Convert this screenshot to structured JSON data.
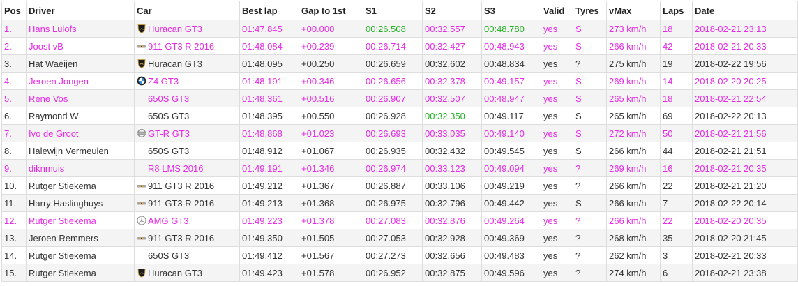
{
  "columns": [
    "Pos",
    "Driver",
    "Car",
    "Best lap",
    "Gap to 1st",
    "S1",
    "S2",
    "S3",
    "Valid",
    "Tyres",
    "vMax",
    "Laps",
    "Date"
  ],
  "colors": {
    "highlight": "#e82ae8",
    "best_sector": "#22b022",
    "text": "#333333",
    "row_alt": "#f4f4f4",
    "border": "#dddddd"
  },
  "rows": [
    {
      "pos": "1.",
      "driver": "Hans Lulofs",
      "logo": "lamborghini-logo-icon",
      "car": "Huracan GT3",
      "best": "01:47.845",
      "gap": "+00.000",
      "s1": "00:26.508",
      "s2": "00:32.557",
      "s3": "00:48.780",
      "valid": "yes",
      "tyres": "S",
      "vmax": "273 km/h",
      "laps": "18",
      "date": "2018-02-21 23:13",
      "hl": true,
      "best_sectors": [
        "s1",
        "s3"
      ]
    },
    {
      "pos": "2.",
      "driver": "Joost vB",
      "logo": "porsche-logo-icon",
      "car": "911 GT3 R 2016",
      "best": "01:48.084",
      "gap": "+00.239",
      "s1": "00:26.714",
      "s2": "00:32.427",
      "s3": "00:48.943",
      "valid": "yes",
      "tyres": "S",
      "vmax": "266 km/h",
      "laps": "42",
      "date": "2018-02-21 20:33",
      "hl": true,
      "best_sectors": []
    },
    {
      "pos": "3.",
      "driver": "Hat Waeijen",
      "logo": "lamborghini-logo-icon",
      "car": "Huracan GT3",
      "best": "01:48.095",
      "gap": "+00.250",
      "s1": "00:26.659",
      "s2": "00:32.602",
      "s3": "00:48.834",
      "valid": "yes",
      "tyres": "?",
      "vmax": "275 km/h",
      "laps": "19",
      "date": "2018-02-22 19:56",
      "hl": false,
      "best_sectors": []
    },
    {
      "pos": "4.",
      "driver": "Jeroen Jongen",
      "logo": "bmw-logo-icon",
      "car": "Z4 GT3",
      "best": "01:48.191",
      "gap": "+00.346",
      "s1": "00:26.656",
      "s2": "00:32.378",
      "s3": "00:49.157",
      "valid": "yes",
      "tyres": "S",
      "vmax": "269 km/h",
      "laps": "14",
      "date": "2018-02-20 20:25",
      "hl": true,
      "best_sectors": []
    },
    {
      "pos": "5.",
      "driver": "Rene Vos",
      "logo": "",
      "car": "650S GT3",
      "best": "01:48.361",
      "gap": "+00.516",
      "s1": "00:26.907",
      "s2": "00:32.507",
      "s3": "00:48.947",
      "valid": "yes",
      "tyres": "S",
      "vmax": "265 km/h",
      "laps": "18",
      "date": "2018-02-21 22:54",
      "hl": true,
      "best_sectors": []
    },
    {
      "pos": "6.",
      "driver": "Raymond W",
      "logo": "",
      "car": "650S GT3",
      "best": "01:48.395",
      "gap": "+00.550",
      "s1": "00:26.928",
      "s2": "00:32.350",
      "s3": "00:49.117",
      "valid": "yes",
      "tyres": "S",
      "vmax": "265 km/h",
      "laps": "69",
      "date": "2018-02-22 20:13",
      "hl": false,
      "best_sectors": [
        "s2"
      ]
    },
    {
      "pos": "7.",
      "driver": "Ivo de Groot",
      "logo": "nissan-logo-icon",
      "car": "GT-R GT3",
      "best": "01:48.868",
      "gap": "+01.023",
      "s1": "00:26.693",
      "s2": "00:33.035",
      "s3": "00:49.140",
      "valid": "yes",
      "tyres": "S",
      "vmax": "272 km/h",
      "laps": "50",
      "date": "2018-02-21 21:56",
      "hl": true,
      "best_sectors": []
    },
    {
      "pos": "8.",
      "driver": "Halewijn Vermeulen",
      "logo": "",
      "car": "650S GT3",
      "best": "01:48.912",
      "gap": "+01.067",
      "s1": "00:26.935",
      "s2": "00:32.432",
      "s3": "00:49.545",
      "valid": "yes",
      "tyres": "S",
      "vmax": "266 km/h",
      "laps": "44",
      "date": "2018-02-21 21:51",
      "hl": false,
      "best_sectors": []
    },
    {
      "pos": "9.",
      "driver": "diknmuis",
      "logo": "",
      "car": "R8 LMS 2016",
      "best": "01:49.191",
      "gap": "+01.346",
      "s1": "00:26.974",
      "s2": "00:33.123",
      "s3": "00:49.094",
      "valid": "yes",
      "tyres": "?",
      "vmax": "269 km/h",
      "laps": "16",
      "date": "2018-02-21 20:35",
      "hl": true,
      "best_sectors": []
    },
    {
      "pos": "10.",
      "driver": "Rutger Stiekema",
      "logo": "porsche-logo-icon",
      "car": "911 GT3 R 2016",
      "best": "01:49.212",
      "gap": "+01.367",
      "s1": "00:26.887",
      "s2": "00:33.106",
      "s3": "00:49.219",
      "valid": "yes",
      "tyres": "?",
      "vmax": "266 km/h",
      "laps": "22",
      "date": "2018-02-21 21:20",
      "hl": false,
      "best_sectors": []
    },
    {
      "pos": "11.",
      "driver": "Harry Haslinghuys",
      "logo": "porsche-logo-icon",
      "car": "911 GT3 R 2016",
      "best": "01:49.213",
      "gap": "+01.368",
      "s1": "00:26.975",
      "s2": "00:32.796",
      "s3": "00:49.442",
      "valid": "yes",
      "tyres": "S",
      "vmax": "266 km/h",
      "laps": "7",
      "date": "2018-02-22 20:14",
      "hl": false,
      "best_sectors": []
    },
    {
      "pos": "12.",
      "driver": "Rutger Stiekema",
      "logo": "mercedes-logo-icon",
      "car": "AMG GT3",
      "best": "01:49.223",
      "gap": "+01.378",
      "s1": "00:27.083",
      "s2": "00:32.876",
      "s3": "00:49.264",
      "valid": "yes",
      "tyres": "?",
      "vmax": "266 km/h",
      "laps": "22",
      "date": "2018-02-20 20:35",
      "hl": true,
      "best_sectors": []
    },
    {
      "pos": "13.",
      "driver": "Jeroen Remmers",
      "logo": "porsche-logo-icon",
      "car": "911 GT3 R 2016",
      "best": "01:49.350",
      "gap": "+01.505",
      "s1": "00:27.053",
      "s2": "00:32.928",
      "s3": "00:49.369",
      "valid": "yes",
      "tyres": "?",
      "vmax": "268 km/h",
      "laps": "35",
      "date": "2018-02-20 21:45",
      "hl": false,
      "best_sectors": []
    },
    {
      "pos": "14.",
      "driver": "Rutger Stiekema",
      "logo": "",
      "car": "650S GT3",
      "best": "01:49.412",
      "gap": "+01.567",
      "s1": "00:27.273",
      "s2": "00:32.656",
      "s3": "00:49.483",
      "valid": "yes",
      "tyres": "?",
      "vmax": "262 km/h",
      "laps": "3",
      "date": "2018-02-21 20:33",
      "hl": false,
      "best_sectors": []
    },
    {
      "pos": "15.",
      "driver": "Rutger Stiekema",
      "logo": "lamborghini-logo-icon",
      "car": "Huracan GT3",
      "best": "01:49.423",
      "gap": "+01.578",
      "s1": "00:26.952",
      "s2": "00:32.875",
      "s3": "00:49.596",
      "valid": "yes",
      "tyres": "?",
      "vmax": "274 km/h",
      "laps": "6",
      "date": "2018-02-21 23:38",
      "hl": false,
      "best_sectors": []
    }
  ]
}
